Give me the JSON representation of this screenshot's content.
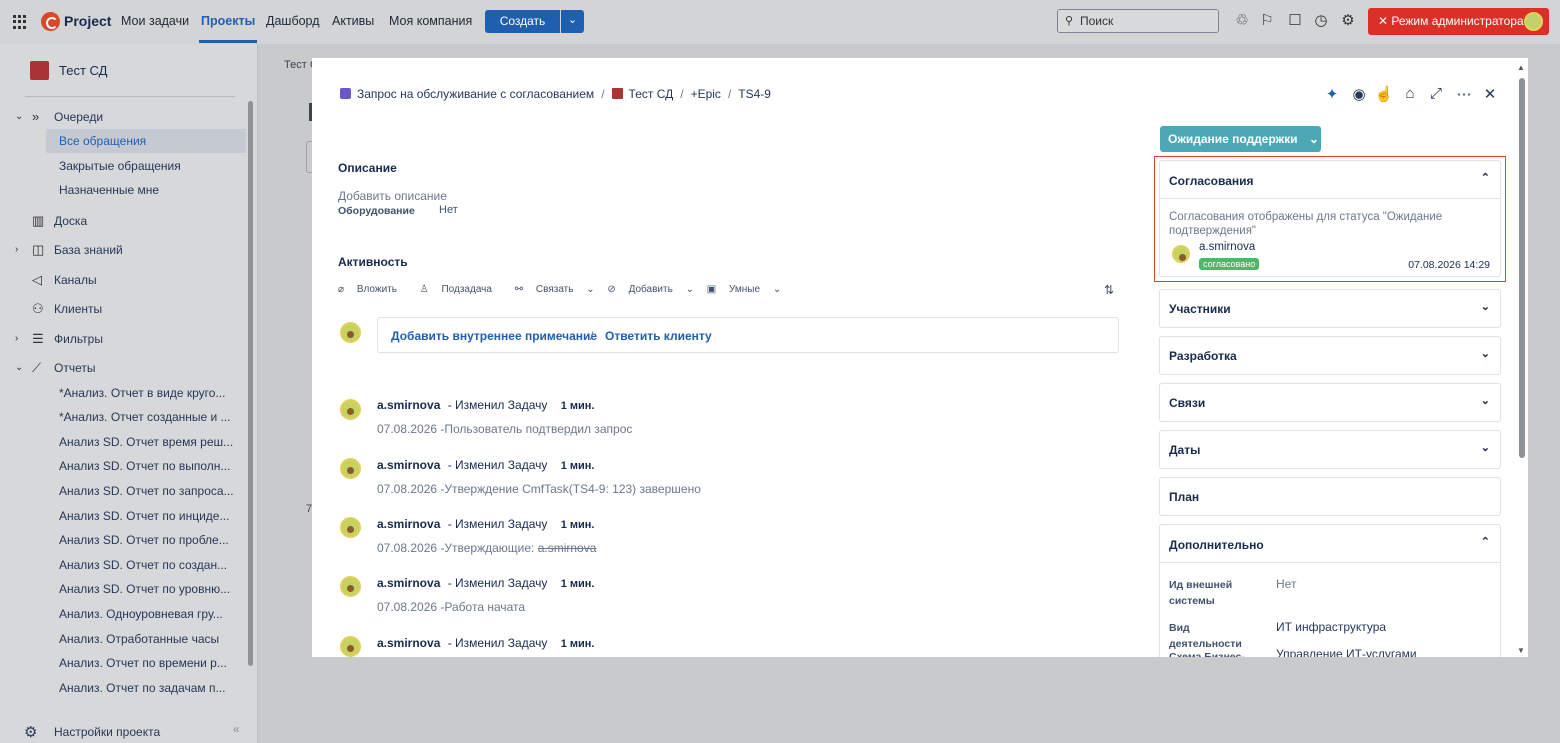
{
  "topbar": {
    "brand": "Project",
    "nav": [
      "Мои задачи",
      "Проекты",
      "Дашборд",
      "Активы",
      "Моя компания"
    ],
    "create_label": "Создать",
    "search_placeholder": "Поиск",
    "admin_label": "✕ Режим администратора"
  },
  "sidebar": {
    "project_name": "Тест СД",
    "queues_label": "Очереди",
    "queue_items": [
      "Все обращения",
      "Закрытые обращения",
      "Назначенные мне"
    ],
    "board_label": "Доска",
    "kb_label": "База знаний",
    "channels_label": "Каналы",
    "clients_label": "Клиенты",
    "filters_label": "Фильтры",
    "reports_label": "Отчеты",
    "report_items": [
      "*Анализ. Отчет в виде круго...",
      "*Анализ. Отчет созданные и ...",
      "Анализ SD. Отчет время реш...",
      "Анализ SD. Отчет по выполн...",
      "Анализ SD. Отчет по запроса...",
      "Анализ SD. Отчет по инциде...",
      "Анализ SD. Отчет по пробле...",
      "Анализ SD. Отчет по создан...",
      "Анализ SD. Отчет по уровню...",
      "Анализ. Одноуровневая гру...",
      "Анализ. Отработанные часы",
      "Анализ. Отчет по времени р...",
      "Анализ. Отчет по задачам п..."
    ],
    "settings_label": "Настройки проекта"
  },
  "background": {
    "crumb": "Тест С",
    "row_num": "7"
  },
  "modal": {
    "crumb": {
      "type": "Запрос на обслуживание с согласованием",
      "project": "Тест СД",
      "epic": "+Epic",
      "key": "TS4-9"
    },
    "status": "Ожидание поддержки",
    "description": {
      "title": "Описание",
      "placeholder": "Добавить описание",
      "equipment_label": "Оборудование",
      "equipment_value": "Нет"
    },
    "activity": {
      "title": "Активность",
      "tools": [
        "Вложить",
        "Подзадача",
        "Связать",
        "Добавить",
        "Умные"
      ],
      "add_internal": "Добавить внутреннее примечание",
      "sep": "/",
      "reply_client": "Ответить клиенту",
      "history": [
        {
          "user": "a.smirnova",
          "action": "-  Изменил Задачу",
          "time": "1 мин.",
          "body": "07.08.2026 -Пользователь подтвердил запрос"
        },
        {
          "user": "a.smirnova",
          "action": "-  Изменил Задачу",
          "time": "1 мин.",
          "body": "07.08.2026 -Утверждение CmfTask(TS4-9: 123) завершено"
        },
        {
          "user": "a.smirnova",
          "action": "-  Изменил Задачу",
          "time": "1 мин.",
          "body_prefix": "07.08.2026 -Утверждающие: ",
          "body_strike": "a.smirnova"
        },
        {
          "user": "a.smirnova",
          "action": "-  Изменил Задачу",
          "time": "1 мин.",
          "body": "07.08.2026 -Работа начата"
        },
        {
          "user": "a.smirnova",
          "action": "-  Изменил Задачу",
          "time": "1 мин."
        }
      ]
    },
    "approvals": {
      "title": "Согласования",
      "note": "Согласования отображены для статуса \"Ожидание подтверждения\"",
      "user": "a.smirnova",
      "badge": "согласовано",
      "date": "07.08.2026 14:29"
    },
    "panels": [
      "Участники",
      "Разработка",
      "Связи",
      "Даты",
      "План"
    ],
    "extra": {
      "title": "Дополнительно",
      "fields": [
        {
          "label": "Ид внешней системы",
          "value": "Нет"
        },
        {
          "label": "Вид деятельности",
          "value": "ИТ инфраструктура"
        },
        {
          "label": "Схема Бизнес-",
          "value": "Управление ИТ-услугами"
        }
      ]
    }
  },
  "colors": {
    "accent": "#1f5fb0",
    "status": "#4ca8b4",
    "admin": "#d93127",
    "approved": "#4bb86a"
  }
}
